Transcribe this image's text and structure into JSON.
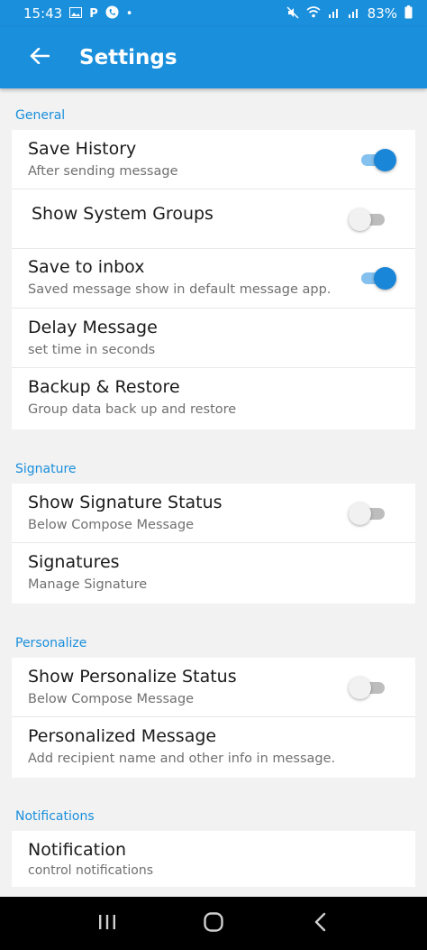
{
  "status_bar": {
    "time": "15:43",
    "battery": "83%",
    "left_icons": [
      "image-icon",
      "p-icon",
      "phone-icon",
      "dot-icon"
    ],
    "right_icons": [
      "mute-icon",
      "wifi-icon",
      "signal-icon",
      "signal-icon",
      "battery-icon"
    ]
  },
  "app_bar": {
    "title": "Settings",
    "back_icon": "arrow-left-icon"
  },
  "sections": {
    "general": {
      "label": "General",
      "items": [
        {
          "title": "Save History",
          "subtitle": "After sending message",
          "toggle": true
        },
        {
          "title": "Show System Groups",
          "subtitle": "",
          "toggle": false
        },
        {
          "title": "Save to inbox",
          "subtitle": "Saved message show in default message app.",
          "toggle": true
        },
        {
          "title": "Delay Message",
          "subtitle": "set time in seconds"
        },
        {
          "title": "Backup & Restore",
          "subtitle": "Group data back up and restore"
        }
      ]
    },
    "signature": {
      "label": "Signature",
      "items": [
        {
          "title": "Show Signature Status",
          "subtitle": "Below Compose Message",
          "toggle": false
        },
        {
          "title": "Signatures",
          "subtitle": "Manage Signature"
        }
      ]
    },
    "personalize": {
      "label": "Personalize",
      "items": [
        {
          "title": "Show Personalize Status",
          "subtitle": "Below Compose Message",
          "toggle": false
        },
        {
          "title": "Personalized Message",
          "subtitle": "Add recipient name and other info in message."
        }
      ]
    },
    "notifications": {
      "label": "Notifications",
      "items": [
        {
          "title": "Notification",
          "subtitle": "control notifications"
        }
      ]
    }
  },
  "nav_bar": {
    "icons": [
      "recents-icon",
      "home-icon",
      "back-icon"
    ]
  },
  "colors": {
    "primary": "#1a8fdc",
    "toggle_on": "#1a86d8",
    "toggle_on_track": "#84c1ee",
    "toggle_off_track": "#bdbdbd",
    "background": "#f2f2f2"
  }
}
